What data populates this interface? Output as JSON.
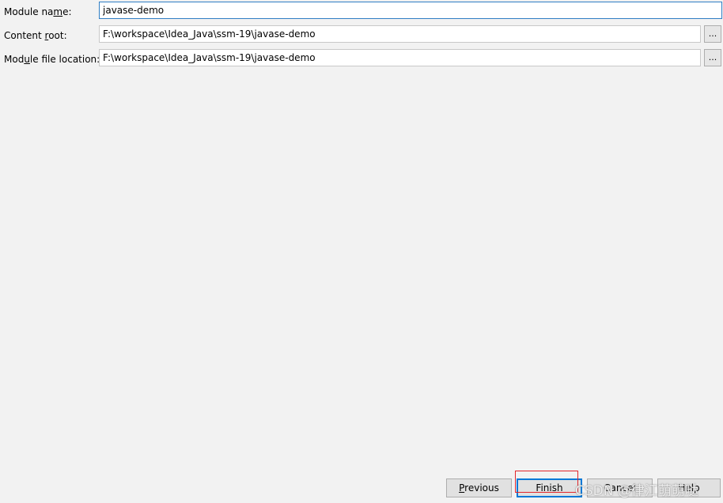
{
  "form": {
    "module_name": {
      "label_pre": "Module na",
      "label_u": "m",
      "label_post": "e:",
      "value": "javase-demo"
    },
    "content_root": {
      "label_pre": "Content ",
      "label_u": "r",
      "label_post": "oot:",
      "value": "F:\\workspace\\Idea_Java\\ssm-19\\javase-demo",
      "browse_label": "..."
    },
    "module_file_location": {
      "label_pre": "Mod",
      "label_u": "u",
      "label_post": "le file location:",
      "value": "F:\\workspace\\Idea_Java\\ssm-19\\javase-demo",
      "browse_label": "..."
    }
  },
  "buttons": {
    "previous": {
      "u": "P",
      "rest": "revious"
    },
    "finish": {
      "u": "F",
      "rest": "inish"
    },
    "cancel": {
      "label": "Cancel"
    },
    "help": {
      "label": "Help"
    }
  },
  "watermark": "CSDN @律江萌萌哒",
  "colors": {
    "focus_border": "#2f7ec4",
    "default_button_border": "#0078d7",
    "highlight_box": "#e2262b"
  }
}
